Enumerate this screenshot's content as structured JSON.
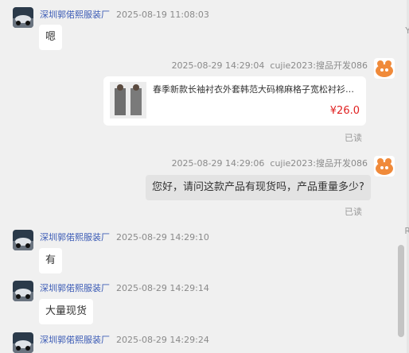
{
  "messages": [
    {
      "side": "left",
      "shop": "深圳郭偌熙服装厂",
      "time": "2025-08-19 11:08:03",
      "text": "嗯"
    },
    {
      "side": "right",
      "time": "2025-08-29 14:29:04",
      "user": "cujie2023:搜品开发086",
      "product": {
        "title": "春季新款长袖衬衣外套韩范大码棉麻格子宽松衬衫女...",
        "price": "¥26.0"
      },
      "status": "已读"
    },
    {
      "side": "right",
      "time": "2025-08-29 14:29:06",
      "user": "cujie2023:搜品开发086",
      "text": "您好，请问这款产品有现货吗，产品重量多少?",
      "status": "已读"
    },
    {
      "side": "left",
      "shop": "深圳郭偌熙服装厂",
      "time": "2025-08-29 14:29:10",
      "text": "有"
    },
    {
      "side": "left",
      "shop": "深圳郭偌熙服装厂",
      "time": "2025-08-29 14:29:14",
      "text": "大量现货"
    },
    {
      "side": "left",
      "shop": "深圳郭偌熙服装厂",
      "time": "2025-08-29 14:29:24"
    }
  ],
  "edge_marks": [
    "Y",
    "R"
  ],
  "icons": {
    "shop_avatar": "car-avatar-icon",
    "self_avatar": "cartoon-avatar-icon"
  },
  "colors": {
    "shop_name": "#3b5bb5",
    "price": "#e02020",
    "background": "#f0f0f0"
  }
}
